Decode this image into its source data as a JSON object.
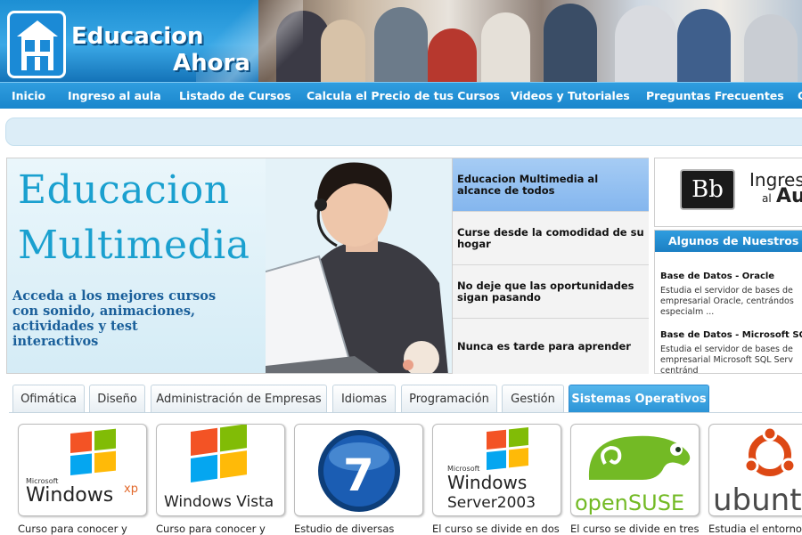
{
  "header": {
    "logo_line1": "Educacion",
    "logo_line2": "Ahora"
  },
  "nav": {
    "items": [
      "Inicio",
      "Ingreso al aula",
      "Listado de Cursos",
      "Calcula el Precio de tus Cursos",
      "Videos y Tutoriales",
      "Preguntas Frecuentes",
      "C"
    ]
  },
  "hero": {
    "title_line1": "Educacion",
    "title_line2": "Multimedia",
    "subtitle": "Acceda a los mejores cursos con sonido, animaciones, actividades y test interactivos"
  },
  "slides": [
    "Educacion Multimedia al alcance de todos",
    "Curse desde la comodidad de su hogar",
    "No deje que las oportunidades sigan pasando",
    "Nunca es tarde para aprender"
  ],
  "aula": {
    "logo": "Bb",
    "line1": "Ingres",
    "line2": "al",
    "line3": "Au"
  },
  "courses": {
    "header": "Algunos de Nuestros",
    "items": [
      {
        "title": "Base de Datos - Oracle",
        "desc": "Estudia el servidor de bases de empresarial Oracle, centrándos especialm ..."
      },
      {
        "title": "Base de Datos - Microsoft SQL S",
        "desc": "Estudia el servidor de bases de empresarial Microsoft SQL Serv centránd"
      }
    ]
  },
  "tabs": [
    "Ofimática",
    "Diseño",
    "Administración de Empresas",
    "Idiomas",
    "Programación",
    "Gestión",
    "Sistemas Operativos"
  ],
  "cards": [
    {
      "logo": "Windows xp",
      "logo_main": "Windows",
      "logo_small": "Microsoft",
      "logo_sup": "xp",
      "text": "Curso para conocer y"
    },
    {
      "logo": "Windows Vista",
      "logo_main": "Windows Vista",
      "logo_small": "",
      "logo_sup": "",
      "text": "Curso para conocer y"
    },
    {
      "logo": "Windows 7",
      "logo_main": "7",
      "logo_small": "",
      "logo_sup": "",
      "text": "Estudio de diversas"
    },
    {
      "logo": "Windows Server 2003",
      "logo_main": "Windows",
      "logo_small": "Microsoft",
      "logo_sup": "Server2003",
      "text": "El curso se divide en dos"
    },
    {
      "logo": "openSUSE",
      "logo_main": "openSUSE",
      "logo_small": "",
      "logo_sup": "",
      "text": "El curso se divide en tres"
    },
    {
      "logo": "ubuntu",
      "logo_main": "ubunt",
      "logo_small": "",
      "logo_sup": "",
      "text": "Estudia el entorno"
    }
  ],
  "colors": {
    "brand_blue": "#1b86cc",
    "active_tab": "#2a93d6",
    "hero_title": "#1aa0cf"
  }
}
